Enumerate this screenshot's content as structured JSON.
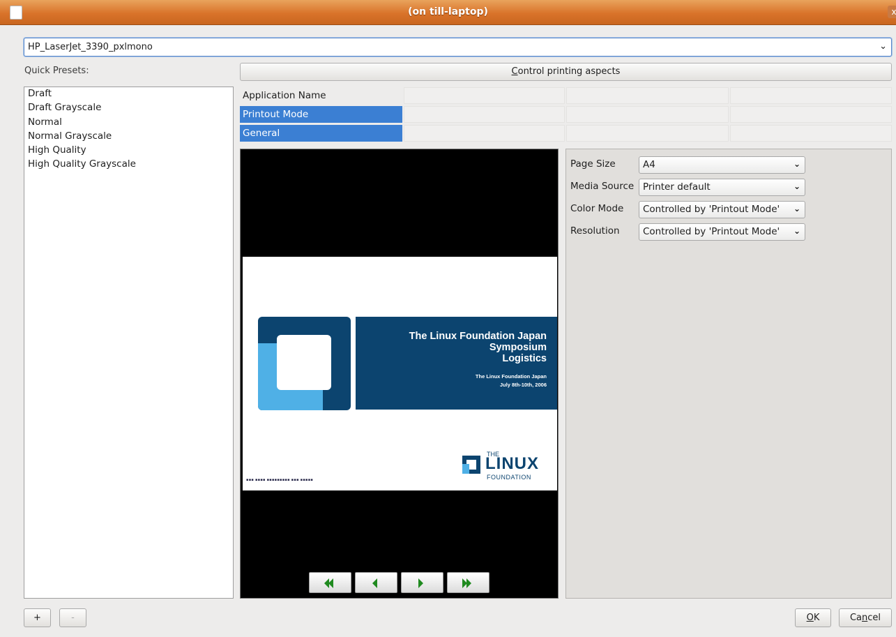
{
  "window": {
    "title": "(on till-laptop)",
    "close_glyph": "x"
  },
  "printer": {
    "selected": "HP_LaserJet_3390_pxlmono"
  },
  "presets": {
    "label": "Quick Presets:",
    "items": [
      "Draft",
      "Draft Grayscale",
      "Normal",
      "Normal Grayscale",
      "High Quality",
      "High Quality Grayscale"
    ],
    "add_label": "+",
    "remove_label": "-"
  },
  "aspects": {
    "button_mnemonic": "C",
    "button_rest": "ontrol printing aspects",
    "rows": [
      {
        "label": "Application Name",
        "selected": false
      },
      {
        "label": "Printout Mode",
        "selected": true
      },
      {
        "label": "General",
        "selected": true
      }
    ]
  },
  "preview": {
    "slide_title_1": "The Linux Foundation Japan",
    "slide_title_2": "Symposium",
    "slide_title_3": "Logistics",
    "slide_sub_1": "The Linux Foundation Japan",
    "slide_sub_2": "July 8th-10th, 2006",
    "logo_the": "THE",
    "logo_linux": "LINUX",
    "logo_foundation": "FOUNDATION",
    "nav_icons": [
      "first-page-icon",
      "previous-page-icon",
      "next-page-icon",
      "last-page-icon"
    ],
    "nav_color": "#1f8a1f"
  },
  "options": [
    {
      "label": "Page Size",
      "value": "A4"
    },
    {
      "label": "Media Source",
      "value": "Printer default"
    },
    {
      "label": "Color Mode",
      "value": "Controlled by 'Printout Mode'"
    },
    {
      "label": "Resolution",
      "value": "Controlled by 'Printout Mode'"
    }
  ],
  "footer": {
    "ok_mnemonic": "O",
    "ok_rest": "K",
    "cancel_pre": "Ca",
    "cancel_mnemonic": "n",
    "cancel_rest": "cel"
  },
  "colors": {
    "titlebar": "#d9732a",
    "selection": "#3b7fd3",
    "brand_dark": "#0c446f",
    "brand_light": "#4fb0e6"
  }
}
